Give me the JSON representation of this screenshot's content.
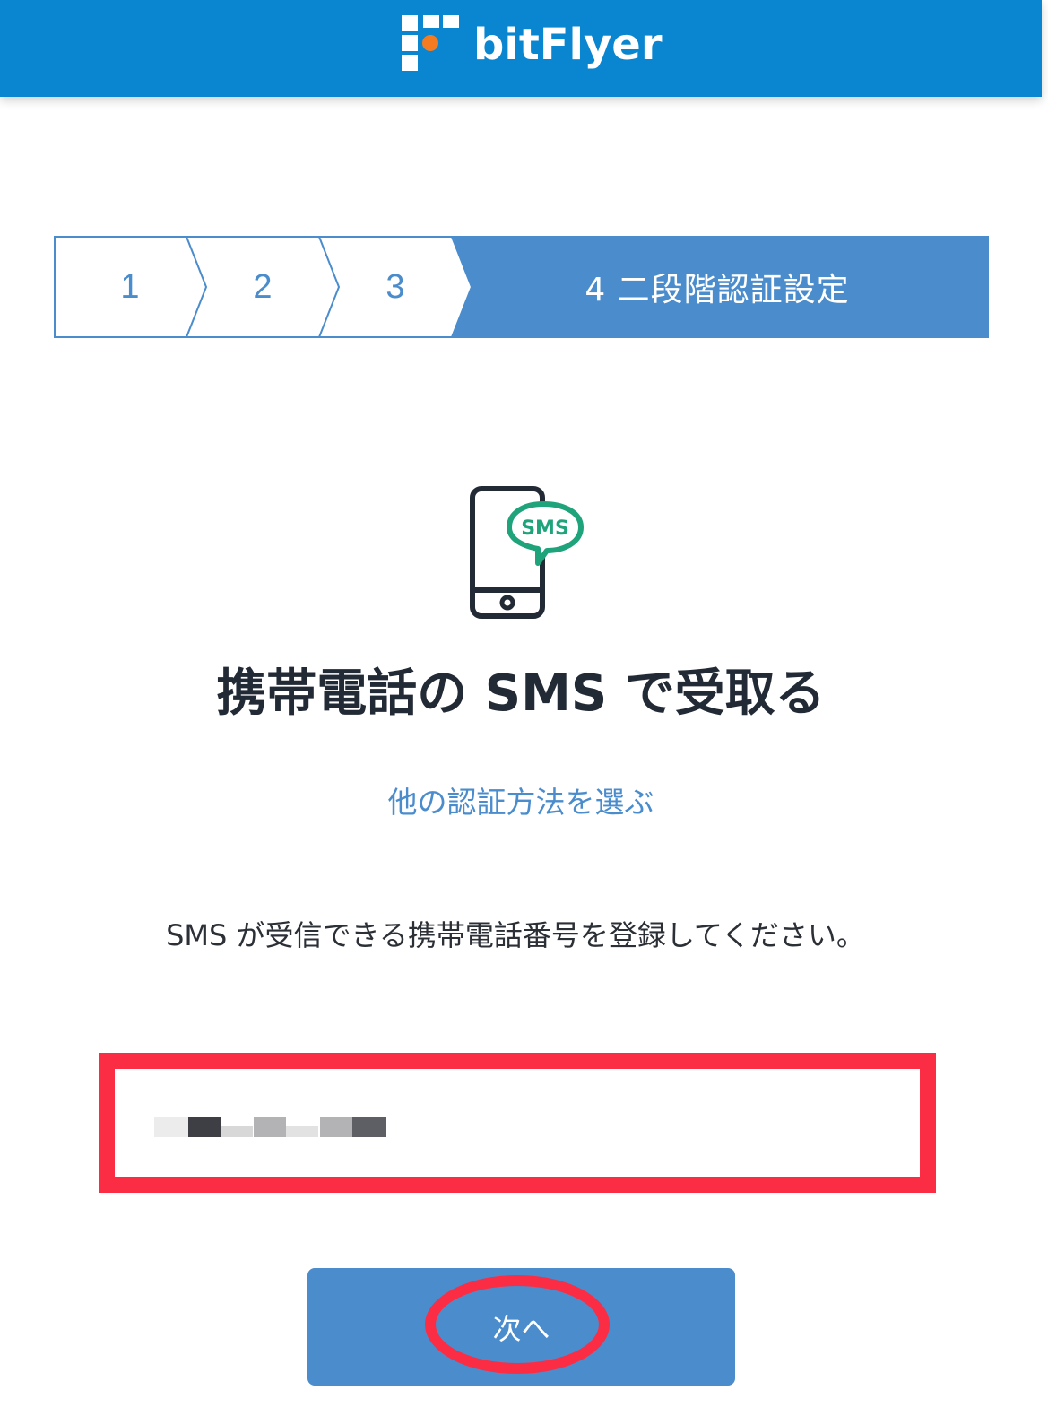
{
  "header": {
    "brand_name": "bitFlyer",
    "logo_icon": "bitflyer-logo-icon",
    "background_color": "#0a86d0",
    "logo_accent_color": "#f47b20"
  },
  "stepper": {
    "steps": [
      {
        "label": "1"
      },
      {
        "label": "2"
      },
      {
        "label": "3"
      },
      {
        "label": "4 二段階認証設定"
      }
    ],
    "active_step": 4,
    "accent_color": "#4a8ccc"
  },
  "main": {
    "icon": "phone-sms-icon",
    "icon_badge_text": "SMS",
    "title": "携帯電話の SMS で受取る",
    "alt_method_link": "他の認証方法を選ぶ",
    "instruction": "SMS が受信できる携帯電話番号を登録してください。"
  },
  "form": {
    "phone_value": ""
  },
  "actions": {
    "next_label": "次へ"
  },
  "annotations": {
    "highlight_color": "#fb2d45"
  }
}
